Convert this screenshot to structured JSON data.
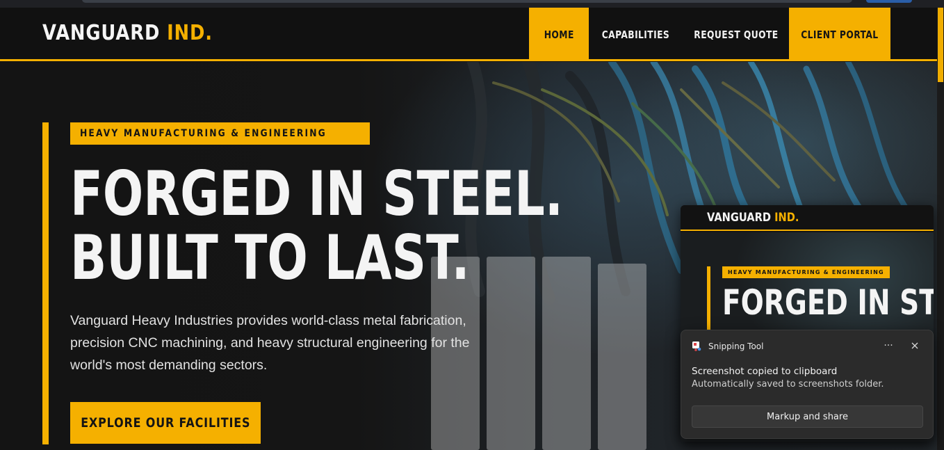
{
  "site": {
    "brand_main": "VANGUARD",
    "brand_accent": "IND.",
    "accent_color": "#f5b000"
  },
  "nav": {
    "items": [
      {
        "label": "HOME",
        "state": "active"
      },
      {
        "label": "CAPABILITIES",
        "state": "default"
      },
      {
        "label": "REQUEST QUOTE",
        "state": "default"
      },
      {
        "label": "CLIENT PORTAL",
        "state": "highlight"
      }
    ]
  },
  "hero": {
    "tag": "HEAVY MANUFACTURING & ENGINEERING",
    "headline_line1": "FORGED IN STEEL.",
    "headline_line2": "BUILT TO LAST.",
    "description": "Vanguard Heavy Industries provides world-class metal fabrication, precision CNC machining, and heavy structural engineering for the world's most demanding sectors.",
    "cta_label": "EXPLORE OUR FACILITIES"
  },
  "preview": {
    "brand_main": "VANGUARD",
    "brand_accent": "IND.",
    "tag": "HEAVY MANUFACTURING & ENGINEERING",
    "headline_line1": "FORGED IN STE"
  },
  "toast": {
    "app_name": "Snipping Tool",
    "app_icon": "snipping-tool-icon",
    "title": "Screenshot copied to clipboard",
    "subtitle": "Automatically saved to screenshots folder.",
    "button_label": "Markup and share",
    "more_label": "···"
  }
}
